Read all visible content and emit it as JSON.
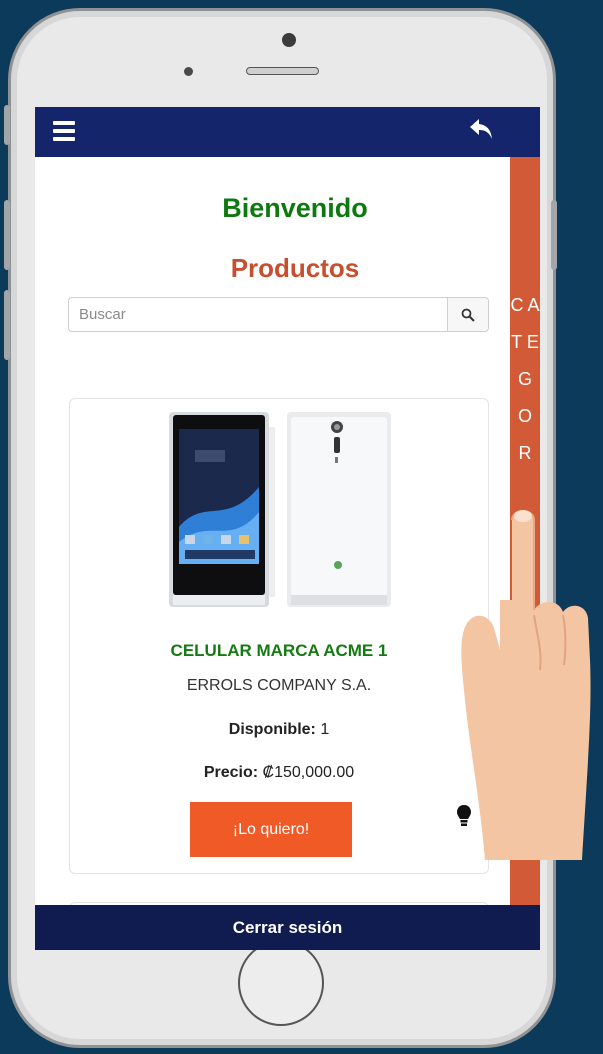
{
  "header": {
    "menu_icon": "hamburger-icon",
    "back_icon": "reply-arrow-icon"
  },
  "side_tab": {
    "label": "C A T E G O R"
  },
  "welcome": "Bienvenido",
  "section_title": "Productos",
  "search": {
    "placeholder": "Buscar",
    "icon": "search-icon"
  },
  "product": {
    "name": "CELULAR MARCA ACME 1",
    "company": "ERROLS COMPANY S.A.",
    "stock_label": "Disponible:",
    "stock_value": "1",
    "price_label": "Precio:",
    "price_value": "₡150,000.00",
    "button_label": "¡Lo quiero!",
    "bulb_icon": "lightbulb-icon"
  },
  "footer": {
    "logout_label": "Cerrar sesión"
  },
  "colors": {
    "background": "#0c3a5a",
    "topbar": "#15256b",
    "welcome": "#0d7a10",
    "section_title": "#c84e30",
    "side_tab": "#d35a37",
    "button": "#f05a26",
    "footer": "#101c4f"
  }
}
